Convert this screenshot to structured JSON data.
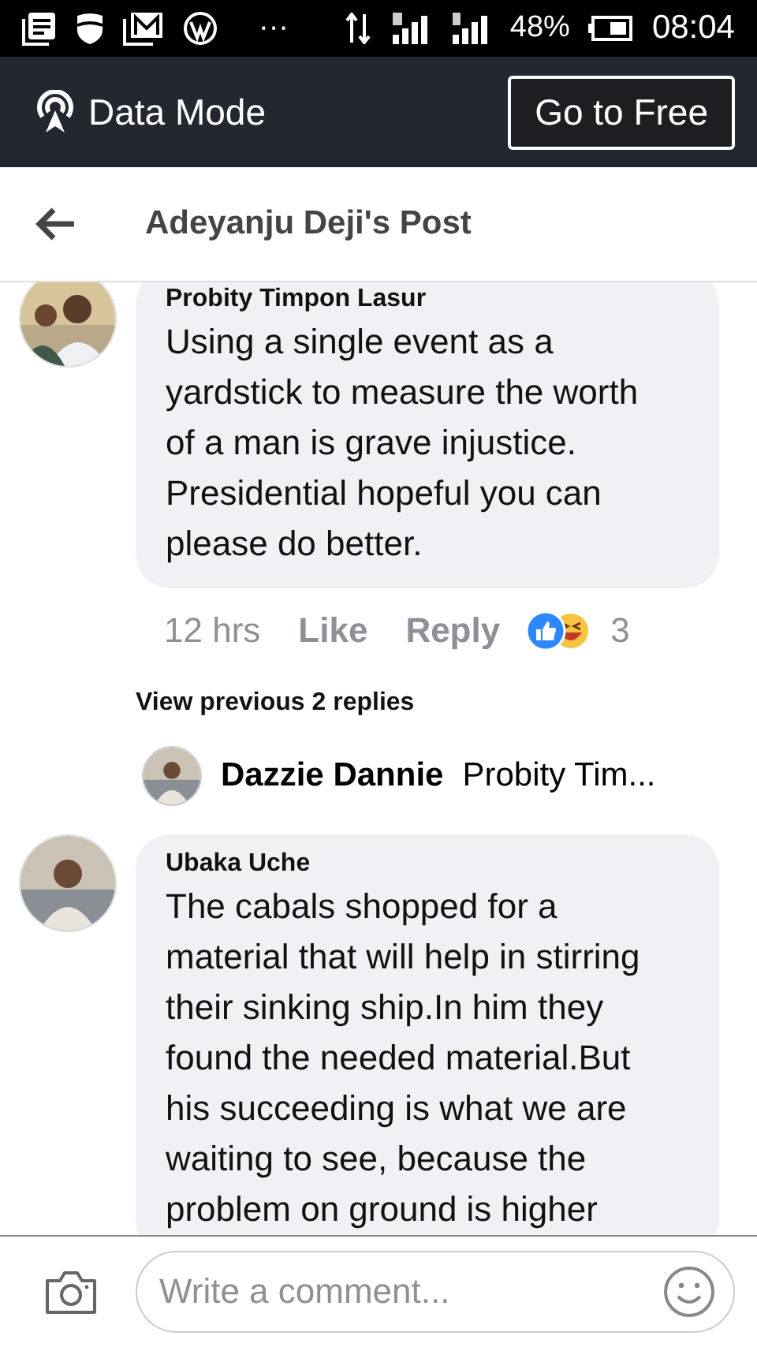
{
  "status_bar": {
    "overflow": "···",
    "battery": "48%",
    "time": "08:04"
  },
  "data_bar": {
    "label": "Data Mode",
    "button": "Go to Free"
  },
  "header": {
    "title": "Adeyanju Deji's Post"
  },
  "comments": [
    {
      "author": "Probity Timpon Lasur",
      "text": "Using a single event as a yardstick to measure the worth of a man is grave injustice. Presidential hopeful you can please do better.",
      "time": "12 hrs",
      "like": "Like",
      "reply": "Reply",
      "reaction_count": "3",
      "view_replies": "View previous 2 replies",
      "latest_reply": {
        "author": "Dazzie Dannie",
        "text": "Probity Tim..."
      }
    },
    {
      "author": "Ubaka Uche",
      "text": "The cabals shopped for a material that will help in stirring their sinking ship.In him they found the needed material.But his succeeding is what we are waiting to see, because the problem on ground is higher"
    }
  ],
  "composer": {
    "placeholder": "Write a comment..."
  }
}
